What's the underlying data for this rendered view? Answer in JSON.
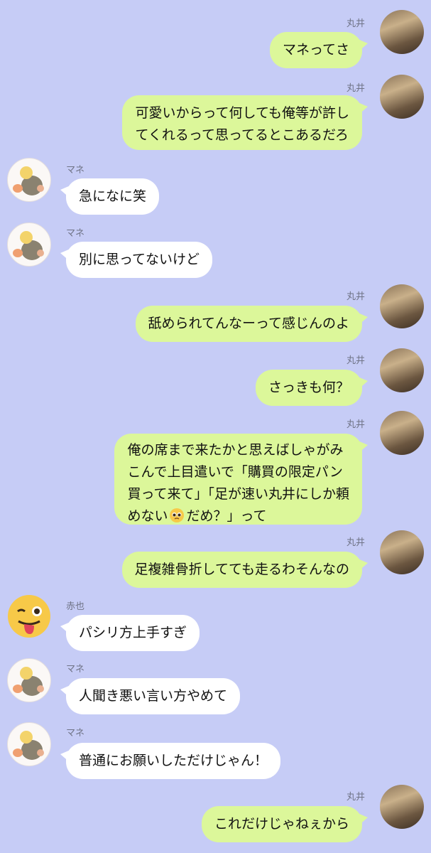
{
  "senders": {
    "marui": "丸井",
    "mane": "マネ",
    "akaya": "赤也"
  },
  "messages": [
    {
      "from": "marui",
      "name": "丸井",
      "lines": [
        "マネってさ"
      ]
    },
    {
      "from": "marui",
      "name": "丸井",
      "lines": [
        "可愛いからって何しても俺等が許し",
        "てくれるって思ってるとこあるだろ"
      ]
    },
    {
      "from": "mane",
      "name": "マネ",
      "lines": [
        "急になに笑"
      ]
    },
    {
      "from": "mane",
      "name": "マネ",
      "lines": [
        "別に思ってないけど"
      ]
    },
    {
      "from": "marui",
      "name": "丸井",
      "lines": [
        "舐められてんなーって感じんのよ"
      ]
    },
    {
      "from": "marui",
      "name": "丸井",
      "lines": [
        "さっきも何？"
      ]
    },
    {
      "from": "marui",
      "name": "丸井",
      "lines": [
        "俺の席まで来たかと思えばしゃがみ",
        "こんで上目遣いで「購買の限定パン",
        "買って来て」「足が速い丸井にしか頼",
        "めない",
        "だめ？」って"
      ],
      "emoji": "pleading-face"
    },
    {
      "from": "marui",
      "name": "丸井",
      "lines": [
        "足複雑骨折してても走るわそんなの"
      ]
    },
    {
      "from": "akaya",
      "name": "赤也",
      "lines": [
        "パシリ方上手すぎ"
      ]
    },
    {
      "from": "mane",
      "name": "マネ",
      "lines": [
        "人聞き悪い言い方やめて"
      ]
    },
    {
      "from": "mane",
      "name": "マネ",
      "lines": [
        "普通にお願いしただけじゃん！"
      ]
    },
    {
      "from": "marui",
      "name": "丸井",
      "lines": [
        "これだけじゃねぇから"
      ]
    }
  ],
  "colors": {
    "background": "#c6ccf6",
    "outgoing_bubble": "#dcf79a",
    "incoming_bubble": "#ffffff",
    "name_text": "#6f7386"
  }
}
